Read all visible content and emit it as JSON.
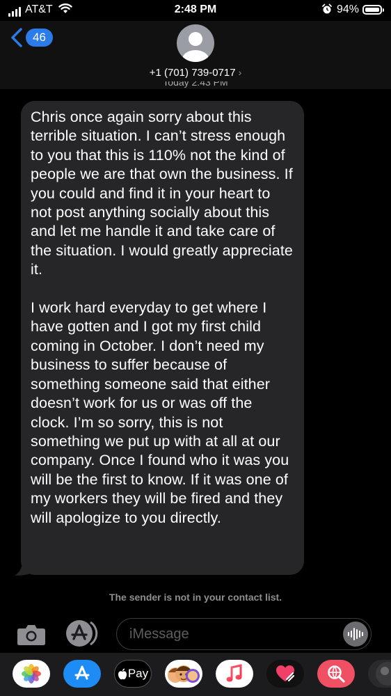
{
  "status_bar": {
    "carrier": "AT&T",
    "time": "2:48 PM",
    "battery": "94%"
  },
  "header": {
    "back_count": "46",
    "contact": "+1 (701) 739-0717",
    "timestamp_partial": "Today 2:43 PM"
  },
  "message": {
    "text": "Chris once again sorry about this terrible situation. I can’t stress enough to you that this is 110% not the kind of people we are that own the business. If you could and find it in your heart to not post anything socially about this and let me handle it and take care of the situation. I would greatly appreciate it.\n\nI work hard everyday to get where I have gotten and I got my first child coming in October. I don’t need my business to suffer because of something someone said that either doesn’t work for us or was off the clock. I’m so sorry, this is not something we put up with at all at our company. Once I found who it was you will be the first to know. If it was one of my workers they will be fired and they will apologize to you directly."
  },
  "notice": "The sender is not in your contact list.",
  "compose": {
    "placeholder": "iMessage"
  },
  "app_drawer": {
    "apple_pay_label": "Pay",
    "apps": [
      "photos-icon",
      "app-store-icon",
      "apple-pay-icon",
      "memoji-icon",
      "music-icon",
      "digital-touch-icon",
      "web-search-icon",
      "more-apps-icon"
    ]
  },
  "colors": {
    "bubble": "#262628",
    "accent": "#2b7be8",
    "background": "#000000"
  }
}
